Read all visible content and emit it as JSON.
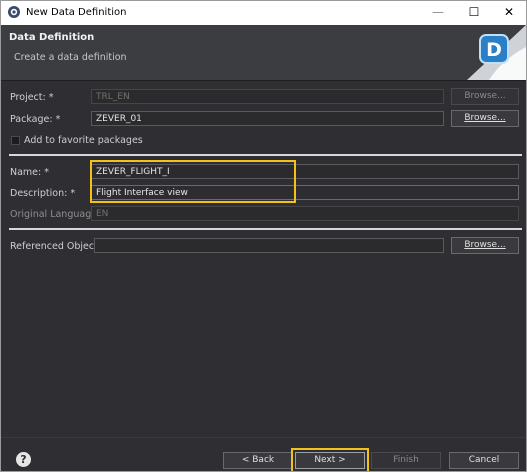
{
  "window": {
    "title": "New Data Definition"
  },
  "banner": {
    "title": "Data Definition",
    "subtitle": "Create a data definition",
    "logo_letter": "D"
  },
  "form": {
    "project_label": "Project: *",
    "project_value": "TRL_EN",
    "package_label": "Package: *",
    "package_value": "ZEVER_01",
    "favorite_label": "Add to favorite packages",
    "name_label": "Name: *",
    "name_value": "ZEVER_FLIGHT_I",
    "description_label": "Description: *",
    "description_value": "Flight Interface view",
    "original_language_label": "Original Language:",
    "original_language_value": "EN",
    "referenced_object_label": "Referenced Object:",
    "referenced_object_value": ""
  },
  "buttons": {
    "browse": "Browse...",
    "back": "< Back",
    "next": "Next >",
    "finish": "Finish",
    "cancel": "Cancel",
    "help": "?"
  },
  "colors": {
    "highlight": "#f2c21b",
    "background": "#2f2f33"
  }
}
